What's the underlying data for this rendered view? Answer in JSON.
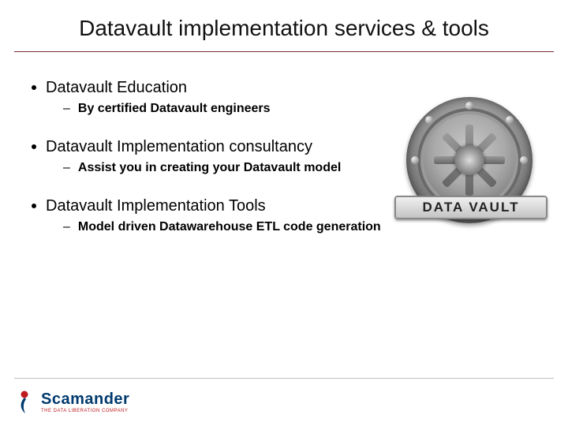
{
  "title": "Datavault implementation services & tools",
  "bullets": [
    {
      "heading": "Datavault Education",
      "sub": "By certified Datavault engineers"
    },
    {
      "heading": "Datavault Implementation consultancy",
      "sub": "Assist you in creating your Datavault model"
    },
    {
      "heading": "Datavault Implementation Tools",
      "sub": "Model driven Datawarehouse ETL code generation"
    }
  ],
  "vault_label": "DATA VAULT",
  "logo": {
    "name": "Scamander",
    "tagline": "THE DATA LIBERATION COMPANY"
  }
}
